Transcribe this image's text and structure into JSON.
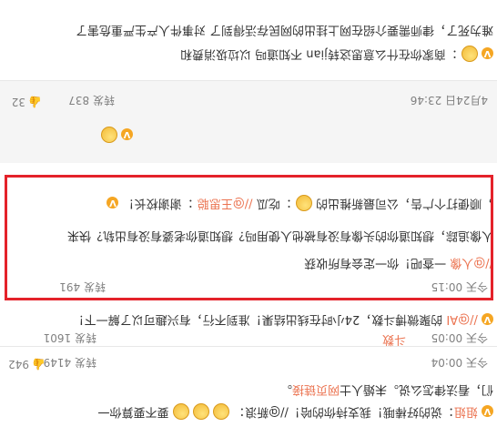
{
  "comments": [
    {
      "lines": [
        {
          "name": "姐姐",
          "text": "：说的好棒哦！我支持你的哈！//@新浪：",
          "extra": "要不要算你一",
          "emojis": 3
        },
        {
          "text": "们，看法律怎么说。未婚人士",
          "link": "网页链接",
          "end": "。"
        }
      ],
      "time": "今天 00:04",
      "reposts": "转发 4149",
      "likes": "942"
    },
    {
      "lines": [
        {
          "name": "",
          "text": "：谢谢校长！",
          "mention": "//@王思聪",
          "text2": "：吃瓜",
          "text3": "，顺便打个广告，公司最新推出"
        },
        {
          "text": "的聚微博斗数，24小时在线出结果！准到不行，有兴趣可以了解一下！",
          "mention": "//@AI"
        }
      ],
      "time": "今天 00:05",
      "reposts": "转发 1601",
      "likes": "",
      "extra_tail": "斗数"
    },
    {
      "highlighted": true,
      "lines": [
        {
          "text": "：谢谢校长！",
          "mention": "//@王思聪",
          "text2": "：吃瓜",
          "text3": "，顺便打个广告，公司最新推出的"
        },
        {
          "text": "人像追踪，想知道你的头像有没有被他人使用吗？想知道你老婆有没有出轨？快来"
        },
        {
          "text": "一查吧！你一定会有所收获",
          "mention": "//@人像"
        }
      ],
      "time": "今天 00:15",
      "reposts": "转发 491",
      "likes": ""
    },
    {
      "lines": [
        {
          "name": "",
          "text": "：",
          "mention": "",
          "text2": ""
        }
      ],
      "time": "4月24日 23:46",
      "reposts": "转发 837",
      "likes": "32"
    },
    {
      "lines": [
        {
          "text": "：商家你在什么意思这转jian",
          "extra": "不知道吗 以垃圾消费和",
          "emojis": 1
        },
        {
          "text": "难为死了，律师需要介绍在网上挂出的网民存活得到了 对事件人产生严重危害了"
        }
      ],
      "time": "",
      "reposts": "",
      "likes": ""
    }
  ]
}
